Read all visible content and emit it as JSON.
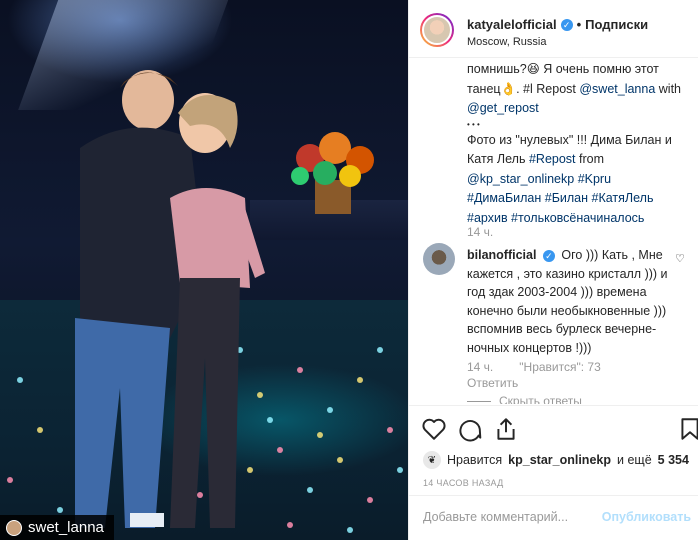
{
  "photo": {
    "tag_user": "swet_lanna"
  },
  "header": {
    "username": "katyalelofficial",
    "separator": "•",
    "follow_label": "Подписки",
    "location": "Moscow, Russia",
    "verified_icon": "verified-badge-icon"
  },
  "caption": {
    "line1": "помнишь?😆 Я очень помню этот",
    "line2": "танец👌. #l Repost",
    "mention1": "@swet_lanna",
    "line2b": " with",
    "mention2": "@get_repost",
    "dots": "• • •",
    "line4": "Фото из \"нулевых\" !!! Дима Билан и Катя Лель",
    "hashtag_repost": "#Repost",
    "from": " from",
    "mention3": "@kp_star_onlinekp",
    "hashtag_kpru": "#Kpru",
    "hashtags_line": "#ДимаБилан #Билан #КатяЛель",
    "hashtags_line2": "#архив #тольковсёначиналось",
    "time": "14 ч."
  },
  "comment": {
    "username": "bilanofficial",
    "text": "Ого ))) Кать , Мне кажется , это казино кристалл ))) и год здак 2003-2004 ))) времена конечно были необыкновенные ))) вспомнив весь бурлеск вечерне-ночных концертов !)))",
    "time": "14 ч.",
    "likes": "\"Нравится\": 73",
    "reply_label": "Ответить",
    "hide_replies": "Скрыть ответы"
  },
  "actions": {
    "like_icon": "heart-icon",
    "comment_icon": "comment-icon",
    "share_icon": "share-icon",
    "save_icon": "bookmark-icon"
  },
  "likes": {
    "prefix": "Нравится",
    "user": "kp_star_onlinekp",
    "suffix": "и ещё",
    "count": "5 354"
  },
  "timestamp": "14 ЧАСОВ НАЗАД",
  "compose": {
    "placeholder": "Добавьте комментарий...",
    "publish_label": "Опубликовать"
  },
  "colors": {
    "link": "#003569",
    "verified": "#3897f0",
    "publish_disabled": "#b2dffc"
  }
}
